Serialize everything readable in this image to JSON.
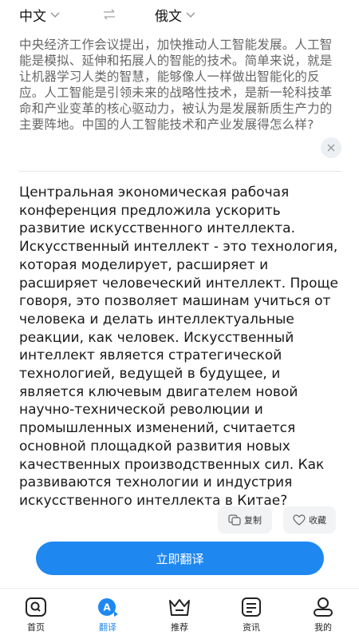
{
  "lang_bar": {
    "source_lang": "中文",
    "target_lang": "俄文"
  },
  "source_text": "中央经济工作会议提出，加快推动人工智能发展。人工智能是模拟、延伸和拓展人的智能的技术。简单来说，就是让机器学习人类的智慧，能够像人一样做出智能化的反应。人工智能是引领未来的战略性技术，是新一轮科技革命和产业变革的核心驱动力，被认为是发展新质生产力的主要阵地。中国的人工智能技术和产业发展得怎么样?",
  "translation_text": "Центральная экономическая рабочая конференция предложила ускорить развитие искусственного интеллекта. Искусственный интеллект - это технология, которая моделирует, расширяет и расширяет человеческий интеллект. Проще говоря, это позволяет машинам учиться от человека и делать интеллектуальные реакции, как человек. Искусственный интеллект является стратегической технологией, ведущей в будущее, и является ключевым двигателем новой научно-технической революции и промышленных изменений, считается основной площадкой развития новых качественных производственных сил. Как развиваются технологии и индустрия искусственного интеллекта в Китае?",
  "actions": {
    "copy_label": "复制",
    "favorite_label": "收藏"
  },
  "translate_button": "立即翻译",
  "nav": {
    "items": [
      {
        "label": "首页",
        "icon": "home-icon"
      },
      {
        "label": "翻译",
        "icon": "translate-icon"
      },
      {
        "label": "推荐",
        "icon": "crown-icon"
      },
      {
        "label": "资讯",
        "icon": "news-icon"
      },
      {
        "label": "我的",
        "icon": "profile-icon"
      }
    ],
    "active_index": 1
  },
  "colors": {
    "accent": "#1e88f0",
    "source_text": "#666666",
    "chip_bg": "#f2f3f5"
  }
}
